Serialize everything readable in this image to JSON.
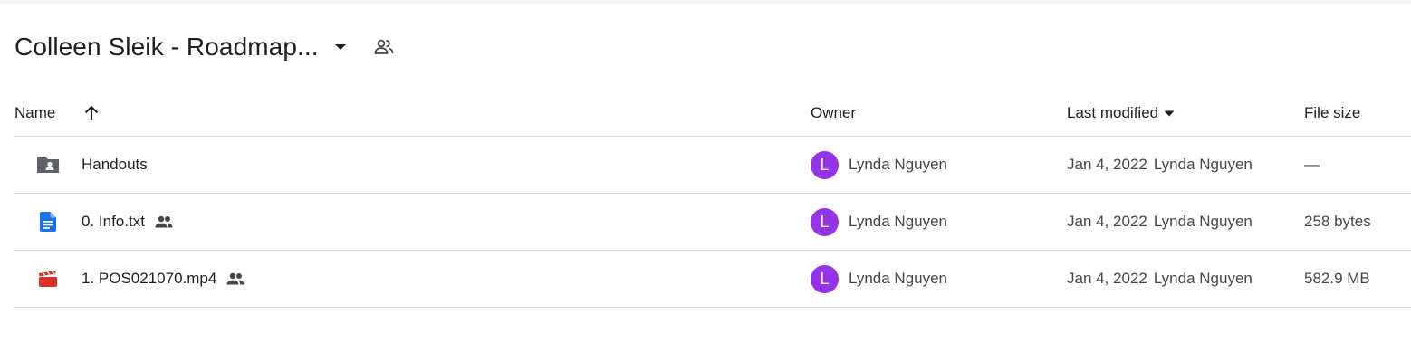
{
  "folder": {
    "title": "Colleen Sleik - Roadmap..."
  },
  "columns": {
    "name": "Name",
    "owner": "Owner",
    "last_modified": "Last modified",
    "file_size": "File size"
  },
  "rows": [
    {
      "name": "Handouts",
      "icon": "shared-folder-icon",
      "shared": false,
      "owner_initial": "L",
      "owner": "Lynda Nguyen",
      "modified_date": "Jan 4, 2022",
      "modified_by": "Lynda Nguyen",
      "size": "—"
    },
    {
      "name": "0. Info.txt",
      "icon": "document-icon",
      "shared": true,
      "owner_initial": "L",
      "owner": "Lynda Nguyen",
      "modified_date": "Jan 4, 2022",
      "modified_by": "Lynda Nguyen",
      "size": "258 bytes"
    },
    {
      "name": "1. POS021070.mp4",
      "icon": "video-icon",
      "shared": true,
      "owner_initial": "L",
      "owner": "Lynda Nguyen",
      "modified_date": "Jan 4, 2022",
      "modified_by": "Lynda Nguyen",
      "size": "582.9 MB"
    }
  ],
  "colors": {
    "avatar": "#9334e6",
    "doc_blue": "#1a73e8",
    "video_red": "#d93025",
    "folder_gray": "#5f6368",
    "divider": "#dadce0"
  }
}
